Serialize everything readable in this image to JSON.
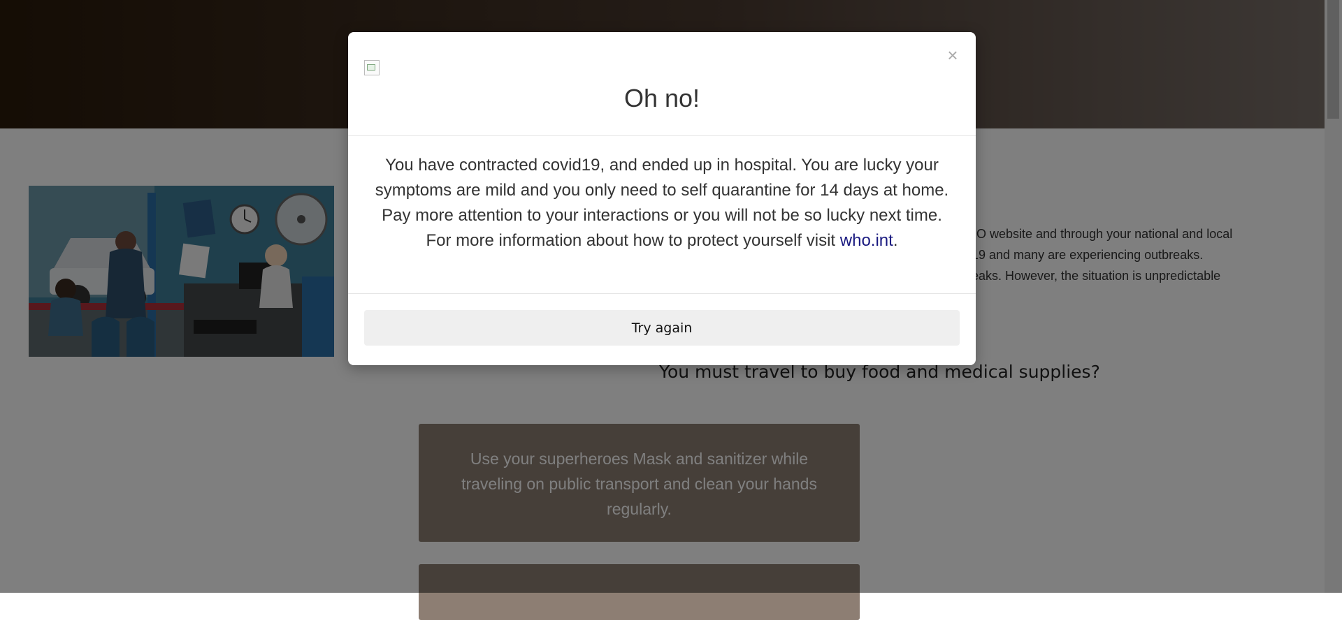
{
  "page": {
    "info_lines": [
      "HO website and through your national and local",
      "-19 and many are experiencing outbreaks.",
      "reaks. However, the situation is unpredictable"
    ],
    "question": "You must travel to buy food and medical supplies?",
    "answers": [
      "Use your superheroes Mask and sanitizer while traveling on public transport and clean your hands regularly."
    ]
  },
  "modal": {
    "close_symbol": "×",
    "title": "Oh no!",
    "message": "You have contracted covid19, and ended up in hospital. You are lucky your symptoms are mild and you only need to self quarantine for 14 days at home. Pay more attention to your interactions or you will not be so lucky next time.",
    "more_info_prefix": "For more information about how to protect yourself visit ",
    "link_text": "who.int",
    "more_info_suffix": ".",
    "button_label": "Try again"
  },
  "colors": {
    "header_gradient_start": "#2a1a0a",
    "answer_bg": "#8d7e73",
    "link": "#1a1a80",
    "overlay": "rgba(0,0,0,0.5)"
  },
  "icons": [
    "broken-image-icon",
    "close-icon"
  ]
}
